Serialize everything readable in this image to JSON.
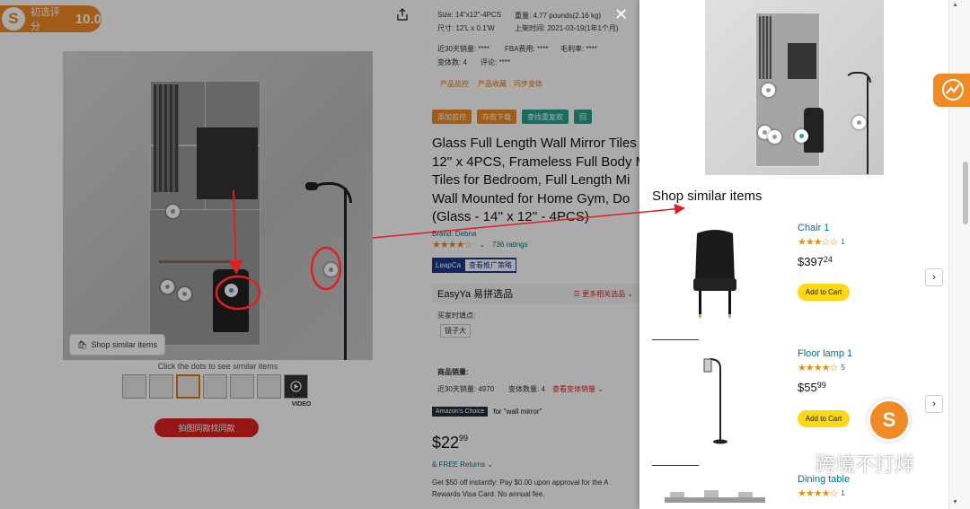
{
  "score_badge": {
    "label": "初选评分",
    "value": "10.0"
  },
  "specs": {
    "size": "Size: 14\"x12\"-4PCS",
    "weight": "重量: 4.77 pounds(2.16 kg)",
    "dims": "尺寸: 12'L x 0.1'W",
    "listed": "上架时间: 2021-03-19(1年1个月)",
    "sales30": "近30天销量: ****",
    "fba": "FBA费用: ****",
    "margin": "毛利率: ****",
    "variants": "变体数: 4",
    "reviews": "评论: ****"
  },
  "links": [
    "产品监控",
    "产品收藏",
    "同步变体"
  ],
  "tags": [
    {
      "label": "添加监控",
      "color": "#f08a24"
    },
    {
      "label": "存款下载",
      "color": "#f08a24"
    },
    {
      "label": "查找重复款",
      "color": "#25a18e"
    },
    {
      "label": "回",
      "color": "#25a18e"
    }
  ],
  "product": {
    "title_lines": [
      "Glass Full Length Wall Mirror Tiles",
      "12'' x 4PCS, Frameless Full Body M",
      "Tiles for Bedroom, Full Length Mi",
      "Wall Mounted for Home Gym, Do",
      "(Glass - 14'' x 12'' - 4PCS)"
    ],
    "brand": "Brand: Debna",
    "stars": "★★★★☆",
    "rating_count": "736 ratings",
    "leap_label": "LeapCa",
    "leap_button": "查看推广策略",
    "easy_label": "EasyYa 易拼选品",
    "easy_link": "☰ 更多相关选品 ⌄",
    "buy_when": "买家时填点:",
    "buy_tag": "镜子大",
    "sales_label": "商品销量:",
    "sales_30": "近30天销量: 4970",
    "variant_count": "变体数量: 4",
    "variant_link": "查看变体销量 ⌄",
    "choice_badge": "Amazon's Choice",
    "choice_text": "for \"wall mirror\"",
    "price_dollars": "$22",
    "price_cents": "99",
    "returns": "& FREE Returns ⌄",
    "promo_1": "Get $50 off instantly: Pay $0.00 upon approval for the A",
    "promo_2": "Rewards Visa Card. No annual fee."
  },
  "image_area": {
    "shop_similar_button": "Shop similar items",
    "click_hint": "Click the dots to see similar items",
    "video_label": "VIDEO",
    "red_button": "拍图同款找同款"
  },
  "panel": {
    "title": "Shop similar items",
    "items": [
      {
        "name": "Chair 1",
        "stars": "★★★☆☆",
        "count": "1",
        "price_dollars": "$397",
        "price_cents": "24",
        "cart": "Add to Cart"
      },
      {
        "name": "Floor lamp 1",
        "stars": "★★★★☆",
        "count": "5",
        "price_dollars": "$55",
        "price_cents": "99",
        "cart": "Add to Cart"
      },
      {
        "name": "Dining table",
        "stars": "★★★★☆",
        "count": "1"
      }
    ]
  },
  "close_icon": "✕",
  "next_icon": "›",
  "watermark": "跨境不打烊",
  "float_logo": "S",
  "colors": {
    "brand_orange": "#f08a24",
    "annotation_red": "#e02020",
    "link_teal": "#007185",
    "cart_yellow": "#ffd814"
  }
}
